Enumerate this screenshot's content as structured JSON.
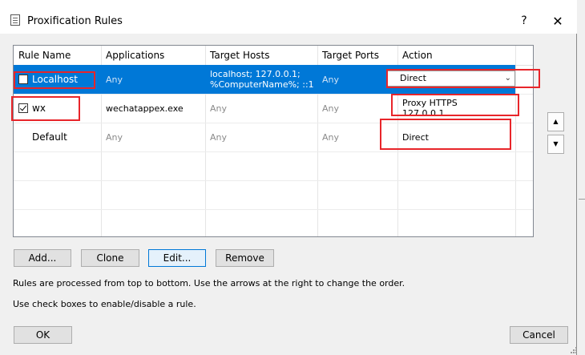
{
  "dialog": {
    "title": "Proxification Rules",
    "help_label": "?",
    "close_label": "✕"
  },
  "table": {
    "columns": [
      "Rule Name",
      "Applications",
      "Target Hosts",
      "Target Ports",
      "Action"
    ],
    "rows": [
      {
        "name": "Localhost",
        "checked": false,
        "applications": "Any",
        "hosts_line1": "localhost; 127.0.0.1;",
        "hosts_line2": "%ComputerName%; ::1",
        "ports": "Any",
        "action": "Direct",
        "selected": true
      },
      {
        "name": "wx",
        "checked": true,
        "applications": "wechatappex.exe",
        "hosts": "Any",
        "ports": "Any",
        "action_line1": "Proxy HTTPS",
        "action_line2": "127.0.0.1"
      },
      {
        "name": "Default",
        "applications": "Any",
        "hosts": "Any",
        "ports": "Any",
        "action": "Direct"
      }
    ]
  },
  "order_buttons": {
    "up_icon": "▲",
    "down_icon": "▼"
  },
  "buttons": {
    "add": "Add...",
    "clone": "Clone",
    "edit": "Edit...",
    "remove": "Remove",
    "ok": "OK",
    "cancel": "Cancel"
  },
  "info": {
    "line1": "Rules are processed from top to bottom. Use the arrows at the right to change the order.",
    "line2": "Use check boxes to enable/disable a rule."
  },
  "colors": {
    "selection": "#0078d7",
    "annotation": "#e8252a"
  },
  "icons": {
    "title": "document-icon",
    "combo": "chevron-down-icon"
  }
}
